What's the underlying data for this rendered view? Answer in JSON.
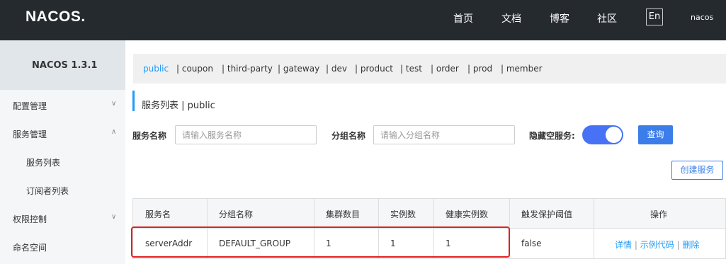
{
  "topbar": {
    "logo": "NACOS.",
    "nav": [
      "首页",
      "文档",
      "博客",
      "社区"
    ],
    "lang": "En",
    "user": "nacos"
  },
  "sidebar": {
    "version": "NACOS 1.3.1",
    "items": [
      {
        "label": "配置管理",
        "chevron": "⌄"
      },
      {
        "label": "服务管理",
        "chevron": "⌃"
      },
      {
        "label": "服务列表"
      },
      {
        "label": "订阅者列表"
      },
      {
        "label": "权限控制",
        "chevron": "⌄"
      },
      {
        "label": "命名空间"
      }
    ]
  },
  "namespaces": [
    "public",
    "| coupon",
    "| third-party",
    "| gateway",
    "| dev",
    "| product",
    "| test",
    "| order",
    "| prod",
    "| member"
  ],
  "page": {
    "title": "服务列表 | public"
  },
  "form": {
    "service_label": "服务名称",
    "service_placeholder": "请输入服务名称",
    "group_label": "分组名称",
    "group_placeholder": "请输入分组名称",
    "hide_empty_label": "隐藏空服务:",
    "query_label": "查询",
    "create_label": "创建服务"
  },
  "table": {
    "headers": [
      "服务名",
      "分组名称",
      "集群数目",
      "实例数",
      "健康实例数",
      "触发保护阈值",
      "操作"
    ],
    "rows": [
      {
        "service": "serverAddr",
        "group": "DEFAULT_GROUP",
        "clusters": "1",
        "instances": "1",
        "healthy": "1",
        "threshold": "false",
        "actions": [
          "详情",
          "示例代码",
          "删除"
        ]
      }
    ]
  },
  "colors": {
    "accent": "#209bfa",
    "button": "#3b7de9",
    "toggle": "#4872f5",
    "highlight": "#e02020"
  }
}
